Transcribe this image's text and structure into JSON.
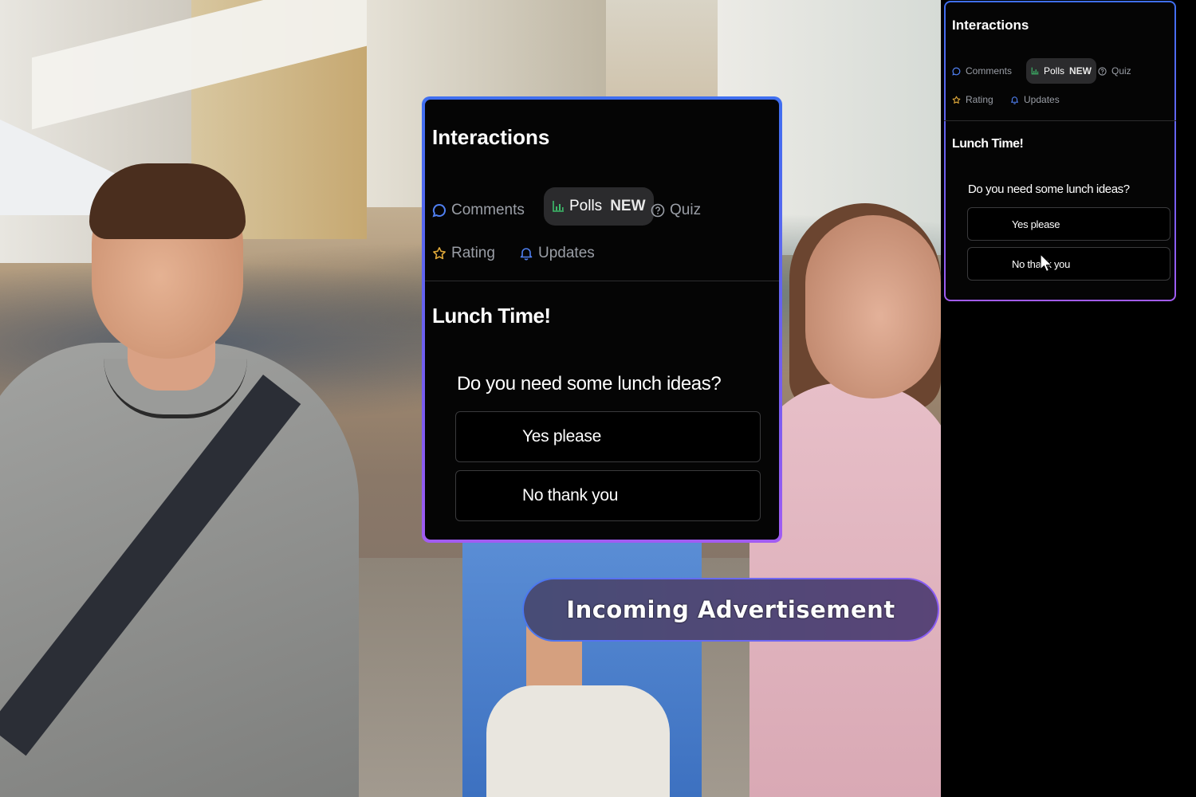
{
  "panel": {
    "title": "Interactions",
    "tabs": {
      "comments": "Comments",
      "polls": "Polls",
      "polls_badge": "NEW",
      "quiz": "Quiz",
      "rating": "Rating",
      "updates": "Updates"
    },
    "poll": {
      "title": "Lunch Time!",
      "question": "Do you need some lunch ideas?",
      "options": [
        "Yes please",
        "No thank you"
      ]
    }
  },
  "ad": {
    "label": "Incoming Advertisement"
  },
  "colors": {
    "panel_bg": "#050505",
    "border_gradient_start": "#3f6ff0",
    "border_gradient_end": "#a25cf2",
    "comments_icon": "#4f7ff0",
    "polls_icon": "#3dbb6a",
    "rating_icon": "#e0a93a",
    "updates_icon": "#4f7ff0"
  }
}
